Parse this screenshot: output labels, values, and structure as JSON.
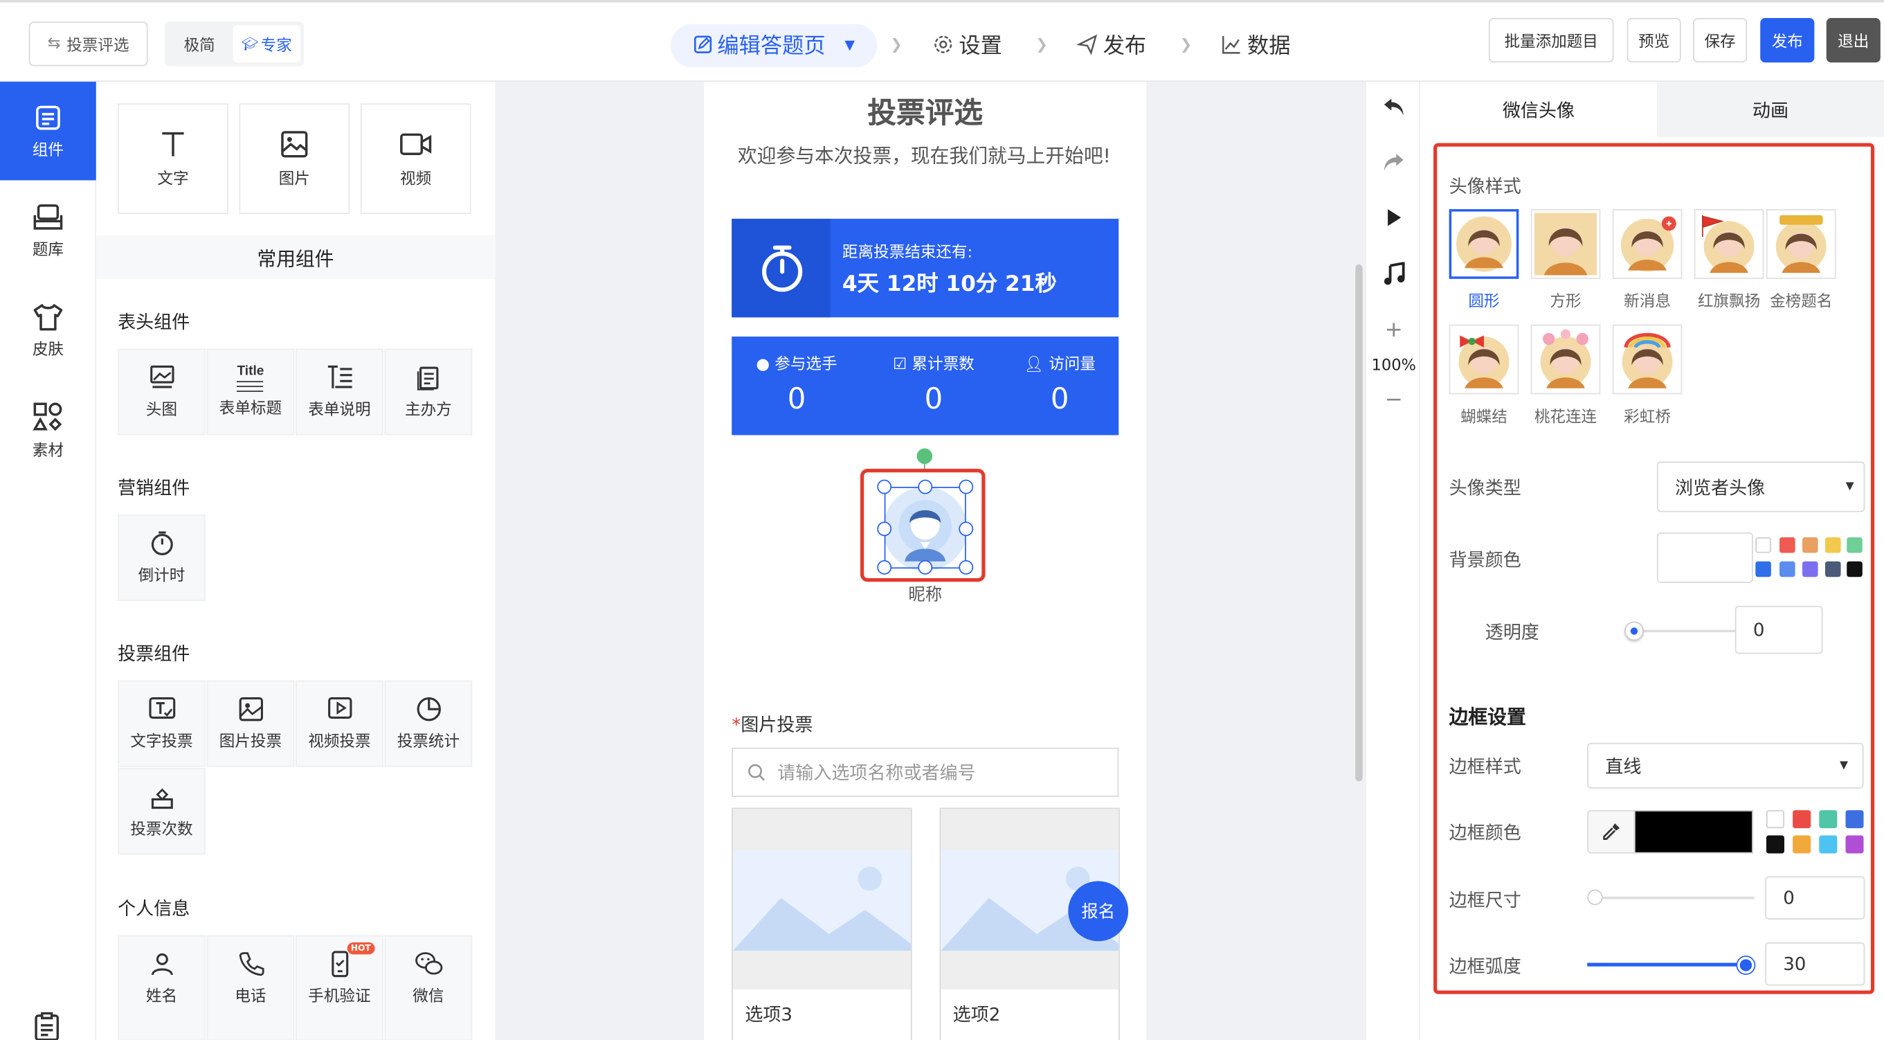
{
  "header": {
    "back_label": "投票评选",
    "mode_simple": "极简",
    "mode_expert": "专家",
    "steps": [
      "编辑答题页",
      "设置",
      "发布",
      "数据"
    ],
    "buttons": {
      "batch_add": "批量添加题目",
      "preview": "预览",
      "save": "保存",
      "publish": "发布",
      "exit": "退出"
    }
  },
  "leftnav": {
    "items": [
      {
        "label": "组件",
        "icon": "components-icon"
      },
      {
        "label": "题库",
        "icon": "question-bank-icon"
      },
      {
        "label": "皮肤",
        "icon": "skin-icon"
      },
      {
        "label": "素材",
        "icon": "material-icon"
      }
    ]
  },
  "components": {
    "basic": [
      "文字",
      "图片",
      "视频"
    ],
    "common_title": "常用组件",
    "header_group": {
      "title": "表头组件",
      "items": [
        "头图",
        "表单标题",
        "表单说明",
        "主办方"
      ]
    },
    "marketing_group": {
      "title": "营销组件",
      "items": [
        "倒计时"
      ]
    },
    "vote_group": {
      "title": "投票组件",
      "items": [
        "文字投票",
        "图片投票",
        "视频投票",
        "投票统计",
        "投票次数"
      ]
    },
    "personal_group": {
      "title": "个人信息",
      "items": [
        "姓名",
        "电话",
        "手机验证",
        "微信"
      ],
      "hot_badge": "HOT"
    },
    "title_icon_text": "Title"
  },
  "canvas": {
    "title": "投票评选",
    "welcome": "欢迎参与本次投票，现在我们就马上开始吧!",
    "countdown": {
      "label": "距离投票结束还有:",
      "value": "4天 12时 10分 21秒"
    },
    "stats": [
      {
        "label": "参与选手",
        "value": "0"
      },
      {
        "label": "累计票数",
        "value": "0"
      },
      {
        "label": "访问量",
        "value": "0"
      }
    ],
    "nickname": "昵称",
    "image_vote_title": "图片投票",
    "required_mark": "*",
    "search_placeholder": "请输入选项名称或者编号",
    "options": [
      "选项3",
      "选项2"
    ],
    "signup": "报名"
  },
  "tools": {
    "zoom": "100%"
  },
  "panel": {
    "tabs": [
      "微信头像",
      "动画"
    ],
    "avatar_style_label": "头像样式",
    "styles": [
      "圆形",
      "方形",
      "新消息",
      "红旗飘扬",
      "金榜题名",
      "蝴蝶结",
      "桃花连连",
      "彩虹桥"
    ],
    "avatar_type_label": "头像类型",
    "avatar_type_value": "浏览者头像",
    "bg_color_label": "背景颜色",
    "opacity_label": "透明度",
    "opacity_value": "0",
    "border_section": "边框设置",
    "border_style_label": "边框样式",
    "border_style_value": "直线",
    "border_color_label": "边框颜色",
    "border_size_label": "边框尺寸",
    "border_size_value": "0",
    "border_radius_label": "边框弧度",
    "border_radius_value": "30"
  },
  "colors": {
    "accent": "#2860f0",
    "highlight_red": "#e23b2e",
    "bg_swatches": [
      "#ffffff",
      "#ef5b52",
      "#e9a063",
      "#f2c94c",
      "#6fcf97",
      "#2f6fe8",
      "#5b8def",
      "#7b6ff0",
      "#4a5a78",
      "#111111"
    ],
    "border_swatches": [
      "#ffffff",
      "#ea4b44",
      "#4fc6a6",
      "#3d6fe0",
      "#111111",
      "#f2a93b",
      "#4cc3f0",
      "#b04fd6"
    ]
  }
}
